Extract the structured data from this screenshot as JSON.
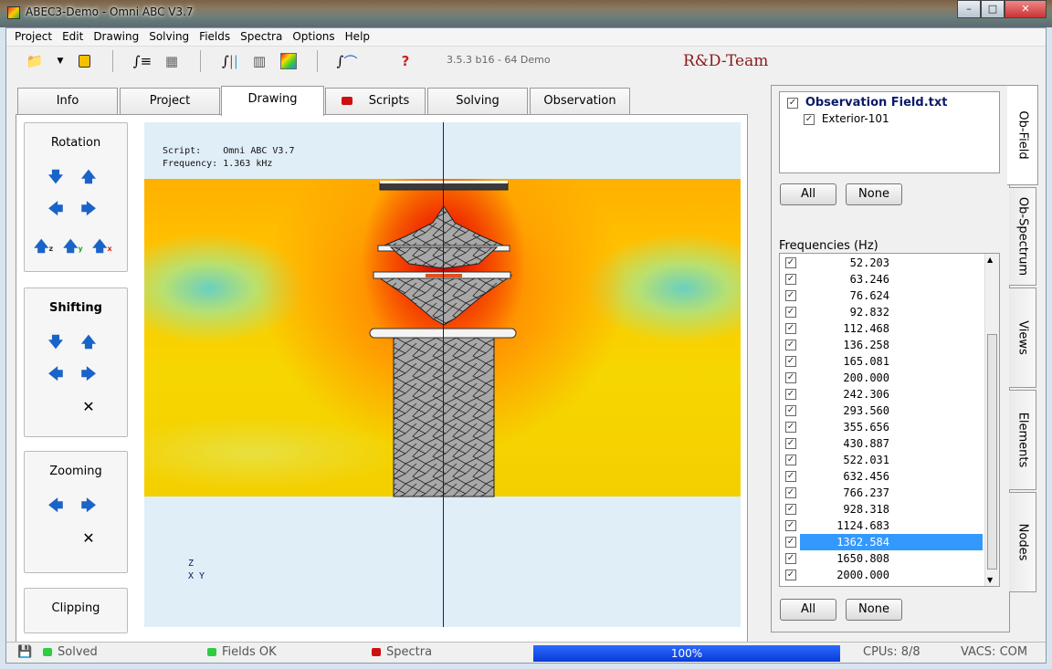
{
  "window": {
    "title": "ABEC3-Demo - Omni ABC V3.7",
    "min": "–",
    "max": "□",
    "close": "✕"
  },
  "menu": [
    "Project",
    "Edit",
    "Drawing",
    "Solving",
    "Fields",
    "Spectra",
    "Options",
    "Help"
  ],
  "toolbar": {
    "version": "3.5.3 b16 - 64 Demo",
    "team": "R&D-Team",
    "icons": [
      "open-folder-icon",
      "dropdown-icon",
      "save-icon",
      "integral-list-icon",
      "mesh-icon",
      "integral-bars-icon",
      "grid-icon",
      "colormap-icon",
      "integral-curve-icon",
      "help-icon"
    ]
  },
  "tabs": [
    "Info",
    "Project",
    "Drawing",
    "Scripts",
    "Solving",
    "Observation"
  ],
  "active_tab": "Drawing",
  "panels": {
    "rotation": "Rotation",
    "shifting": "Shifting",
    "zooming": "Zooming",
    "clipping": "Clipping"
  },
  "view": {
    "script_line": "Script:    Omni ABC V3.7",
    "freq_line": "Frequency: 1.363 kHz",
    "axis_z": "Z",
    "axis_xy": "X Y"
  },
  "observation": {
    "file": "Observation Field.txt",
    "child": "Exterior-101",
    "all": "All",
    "none": "None"
  },
  "frequencies": {
    "label": "Frequencies  (Hz)",
    "values": [
      "52.203",
      "63.246",
      "76.624",
      "92.832",
      "112.468",
      "136.258",
      "165.081",
      "200.000",
      "242.306",
      "293.560",
      "355.656",
      "430.887",
      "522.031",
      "632.456",
      "766.237",
      "928.318",
      "1124.683",
      "1362.584",
      "1650.808",
      "2000.000"
    ],
    "selected": "1362.584",
    "all": "All",
    "none": "None"
  },
  "side_tabs": [
    "Ob-Field",
    "Ob-Spectrum",
    "Views",
    "Elements",
    "Nodes"
  ],
  "status": {
    "solved": "Solved",
    "fields": "Fields OK",
    "spectra": "Spectra",
    "progress": "100%",
    "progress_value": 1.0,
    "cpus": "CPUs: 8/8",
    "vacs": "VACS: COM"
  },
  "colors": {
    "ok": "#2ecc40",
    "error": "#cc1111",
    "selection": "#3399ff",
    "progress": "#0a3ad8"
  }
}
